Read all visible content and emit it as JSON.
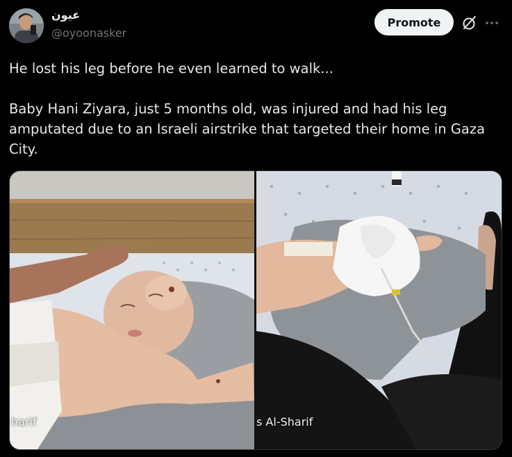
{
  "author": {
    "display_name": "عيون",
    "handle": "@oyoonasker"
  },
  "actions": {
    "promote_label": "Promote",
    "grok_icon": "grok-icon",
    "more_icon": "more-dots-icon"
  },
  "post": {
    "line1": "He lost his leg before he even learned to walk...",
    "paragraph2": "Baby Hani Ziyara, just 5 months old, was injured and had his leg amputated due to an Israeli airstrike that targeted their home in Gaza City."
  },
  "media": {
    "left_caption": "harif",
    "right_caption": "s Al-Sharif"
  },
  "colors": {
    "background": "#000000",
    "text": "#e7e9ea",
    "secondary_text": "#71767b",
    "promote_bg": "#eff3f4",
    "promote_text": "#0f1419"
  }
}
